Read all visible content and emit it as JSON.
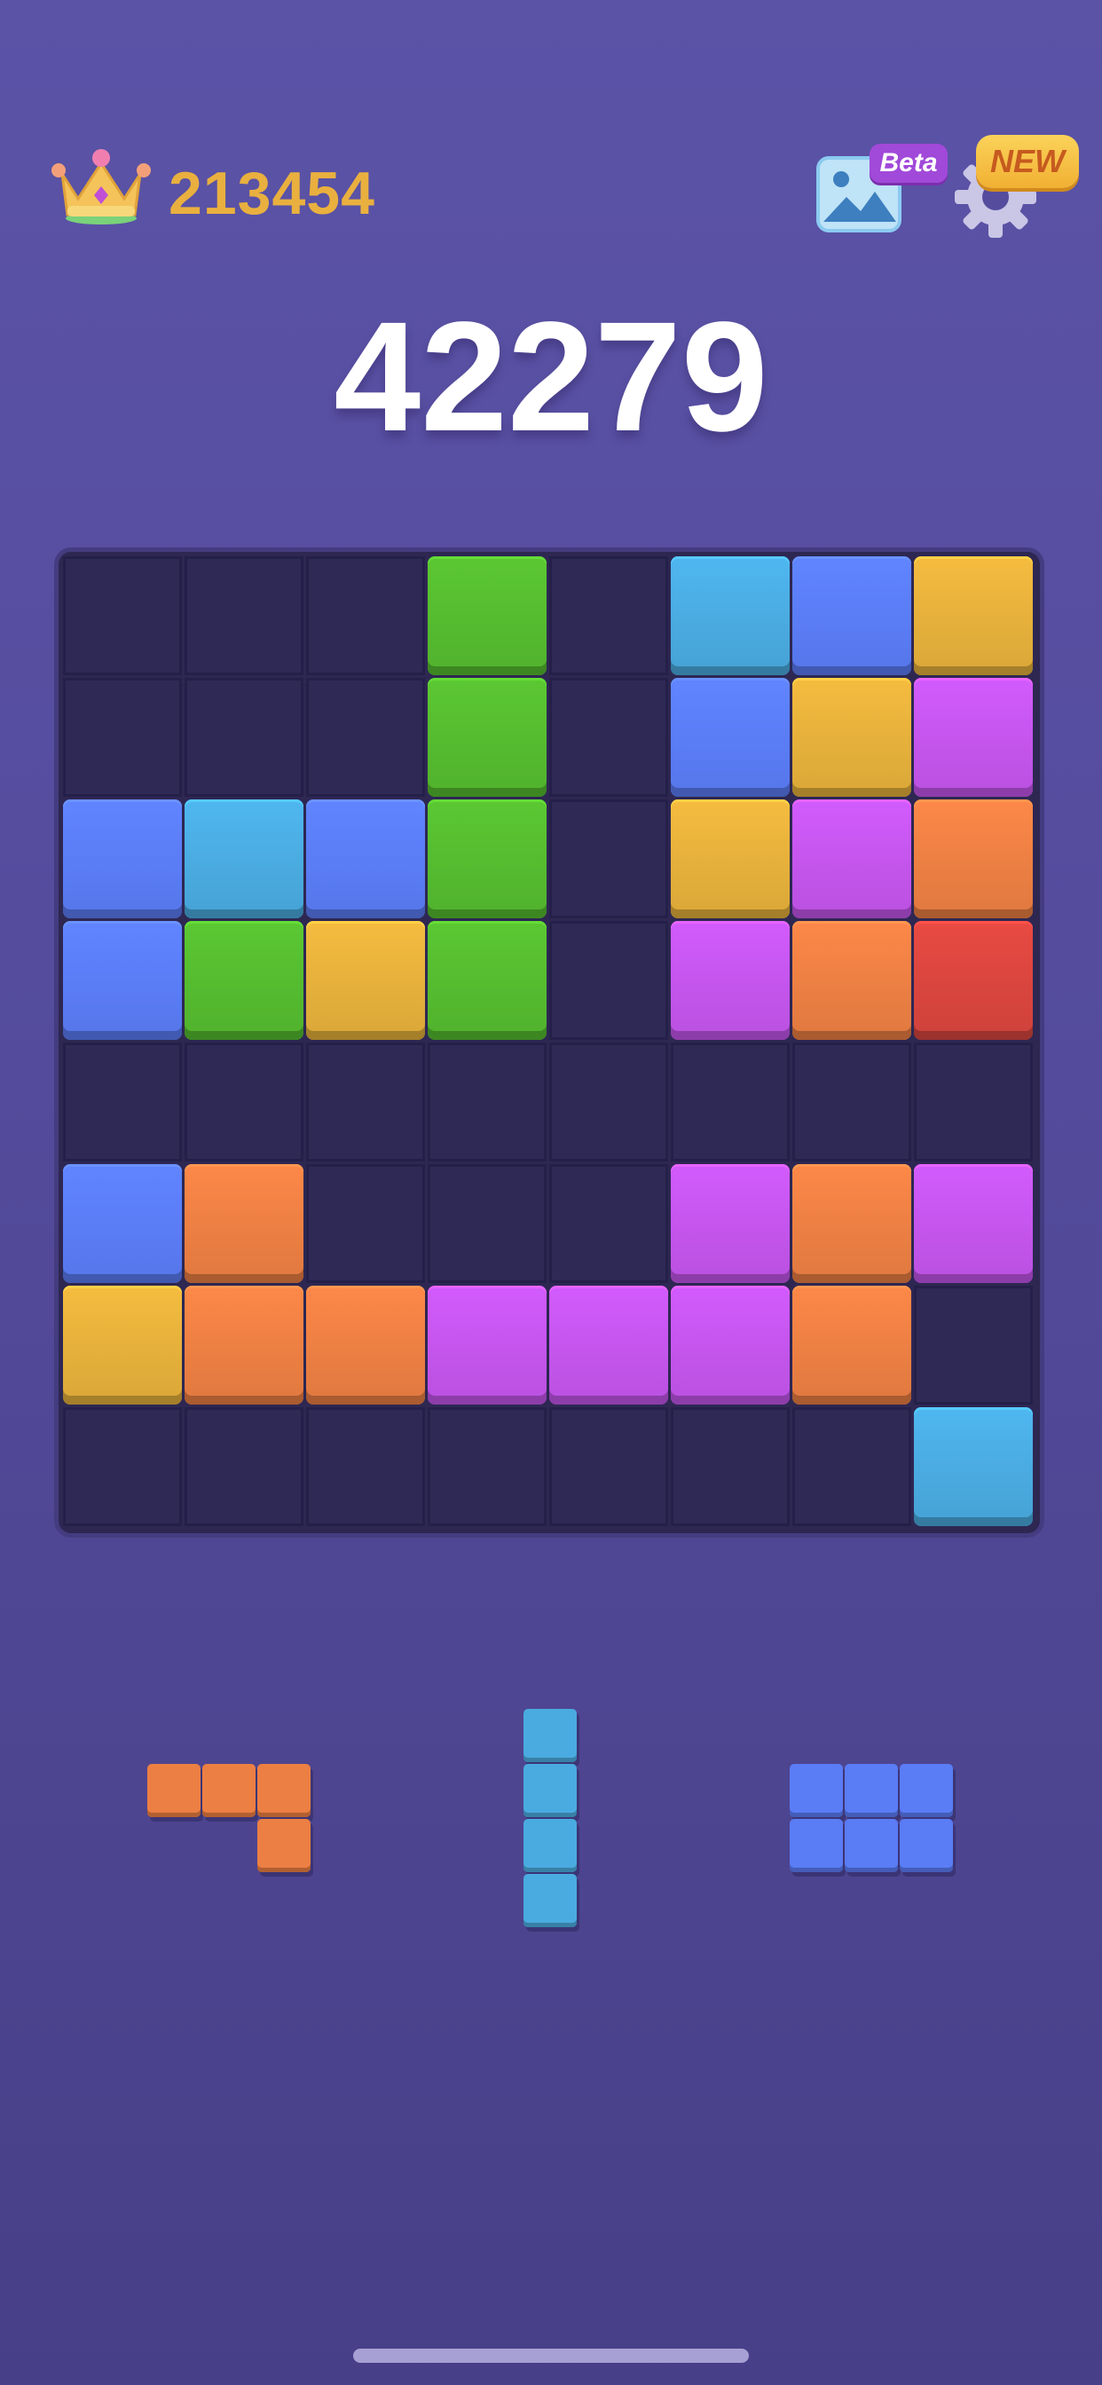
{
  "header": {
    "best_score": "213454",
    "beta_label": "Beta",
    "new_label": "NEW",
    "icons": {
      "crown": "crown-icon",
      "gallery": "gallery-icon",
      "settings": "gear-icon"
    }
  },
  "score": {
    "current": "42279"
  },
  "colors": {
    "green": "#55bb2f",
    "cyan": "#4aabe0",
    "blue": "#5a7cf5",
    "yellow": "#e5b03b",
    "purple": "#c455ec",
    "orange": "#ec7f43",
    "red": "#d9453e"
  },
  "board": {
    "rows": 8,
    "cols": 8,
    "cells": [
      [
        null,
        null,
        null,
        "green",
        null,
        "cyan",
        "blue",
        "yellow"
      ],
      [
        null,
        null,
        null,
        "green",
        null,
        "blue",
        "yellow",
        "purple"
      ],
      [
        "blue",
        "cyan",
        "blue",
        "green",
        null,
        "yellow",
        "purple",
        "orange"
      ],
      [
        "blue",
        "green",
        "yellow",
        "green",
        null,
        "purple",
        "orange",
        "red"
      ],
      [
        null,
        null,
        null,
        null,
        null,
        null,
        null,
        null
      ],
      [
        "blue",
        "orange",
        null,
        null,
        null,
        "purple",
        "orange",
        "purple"
      ],
      [
        "yellow",
        "orange",
        "orange",
        "purple",
        "purple",
        "purple",
        "orange",
        null
      ],
      [
        null,
        null,
        null,
        null,
        null,
        null,
        null,
        "cyan"
      ]
    ]
  },
  "pieces": [
    {
      "color": "orange",
      "cells": [
        [
          0,
          0
        ],
        [
          0,
          1
        ],
        [
          0,
          2
        ],
        [
          1,
          2
        ]
      ]
    },
    {
      "color": "cyan",
      "cells": [
        [
          0,
          0
        ],
        [
          1,
          0
        ],
        [
          2,
          0
        ],
        [
          3,
          0
        ]
      ]
    },
    {
      "color": "blue",
      "cells": [
        [
          0,
          0
        ],
        [
          0,
          1
        ],
        [
          0,
          2
        ],
        [
          1,
          0
        ],
        [
          1,
          1
        ],
        [
          1,
          2
        ]
      ]
    }
  ]
}
